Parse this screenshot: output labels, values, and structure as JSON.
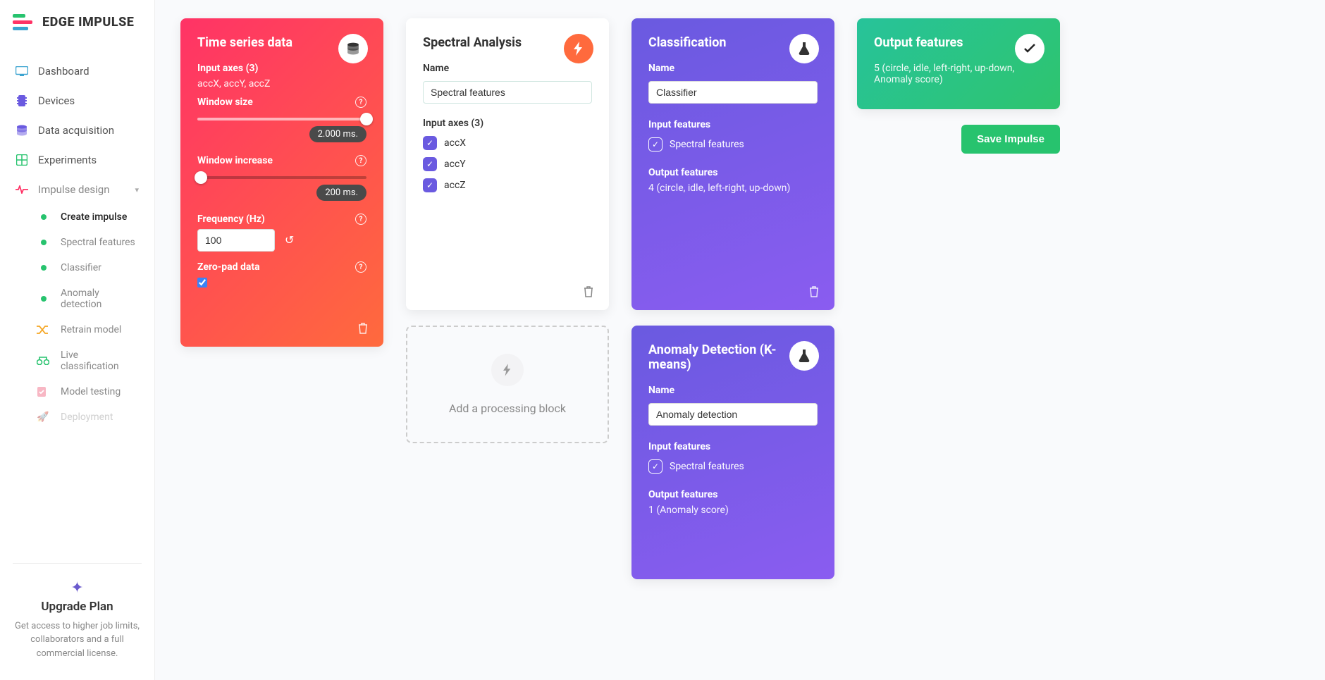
{
  "brand": "EDGE IMPULSE",
  "sidebar": {
    "items": [
      {
        "label": "Dashboard"
      },
      {
        "label": "Devices"
      },
      {
        "label": "Data acquisition"
      },
      {
        "label": "Experiments"
      },
      {
        "label": "Impulse design"
      }
    ],
    "sub": [
      {
        "label": "Create impulse",
        "active": true
      },
      {
        "label": "Spectral features"
      },
      {
        "label": "Classifier"
      },
      {
        "label": "Anomaly detection"
      },
      {
        "label": "Retrain model"
      },
      {
        "label": "Live classification"
      },
      {
        "label": "Model testing"
      },
      {
        "label": "Deployment"
      }
    ],
    "upgrade": {
      "title": "Upgrade Plan",
      "text": "Get access to higher job limits, collaborators and a full commercial license."
    }
  },
  "timeseries": {
    "title": "Time series data",
    "input_axes_label": "Input axes (3)",
    "input_axes": "accX, accY, accZ",
    "window_size_label": "Window size",
    "window_size_value": "2.000 ms.",
    "window_increase_label": "Window increase",
    "window_increase_value": "200 ms.",
    "frequency_label": "Frequency (Hz)",
    "frequency_value": "100",
    "zeropad_label": "Zero-pad data"
  },
  "spectral": {
    "title": "Spectral Analysis",
    "name_label": "Name",
    "name_value": "Spectral features",
    "input_axes_label": "Input axes (3)",
    "axes": [
      "accX",
      "accY",
      "accZ"
    ]
  },
  "add_processing": "Add a processing block",
  "classification": {
    "title": "Classification",
    "name_label": "Name",
    "name_value": "Classifier",
    "input_features_label": "Input features",
    "input_feature": "Spectral features",
    "output_features_label": "Output features",
    "output_features": "4 (circle, idle, left-right, up-down)"
  },
  "anomaly": {
    "title": "Anomaly Detection (K-means)",
    "name_label": "Name",
    "name_value": "Anomaly detection",
    "input_features_label": "Input features",
    "input_feature": "Spectral features",
    "output_features_label": "Output features",
    "output_features": "1 (Anomaly score)"
  },
  "output": {
    "title": "Output features",
    "text": "5 (circle, idle, left-right, up-down, Anomaly score)"
  },
  "save_button": "Save Impulse"
}
